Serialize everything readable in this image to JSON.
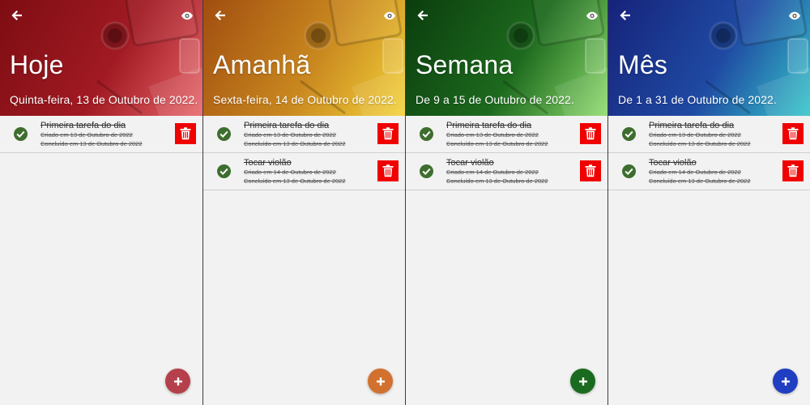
{
  "screens": [
    {
      "title": "Hoje",
      "subtitle": "Quinta-feira, 13 de Outubro de 2022.",
      "header_gradient": [
        "#7d0d12",
        "#a11a23",
        "#e8666a"
      ],
      "fab_color": "#b5404b",
      "tasks": [
        {
          "name": "Primeira tarefa do dia",
          "created": "Criado em 13 de Outubro de 2022",
          "done": "Concluído em 13 de Outubro de 2022"
        }
      ]
    },
    {
      "title": "Amanhã",
      "subtitle": "Sexta-feira, 14 de Outubro de 2022.",
      "header_gradient": [
        "#a14e10",
        "#c9881f",
        "#f3d23a"
      ],
      "fab_color": "#d2712f",
      "tasks": [
        {
          "name": "Primeira tarefa do dia",
          "created": "Criado em 13 de Outubro de 2022",
          "done": "Concluído em 13 de Outubro de 2022"
        },
        {
          "name": "Tocar violão",
          "created": "Criado em 14 de Outubro de 2022",
          "done": "Concluído em 13 de Outubro de 2022"
        }
      ]
    },
    {
      "title": "Semana",
      "subtitle": "De 9 a 15 de Outubro de 2022.",
      "header_gradient": [
        "#0b3d0e",
        "#1d6a1e",
        "#8fdc6e"
      ],
      "fab_color": "#1a6b1f",
      "tasks": [
        {
          "name": "Primeira tarefa do dia",
          "created": "Criado em 13 de Outubro de 2022",
          "done": "Concluído em 13 de Outubro de 2022"
        },
        {
          "name": "Tocar violão",
          "created": "Criado em 14 de Outubro de 2022",
          "done": "Concluído em 13 de Outubro de 2022"
        }
      ]
    },
    {
      "title": "Mês",
      "subtitle": "De 1 a 31 de Outubro de 2022.",
      "header_gradient": [
        "#16237a",
        "#1f4aa3",
        "#36c6c9"
      ],
      "fab_color": "#1f3ec2",
      "tasks": [
        {
          "name": "Primeira tarefa do dia",
          "created": "Criado em 13 de Outubro de 2022",
          "done": "Concluído em 13 de Outubro de 2022"
        },
        {
          "name": "Tocar violão",
          "created": "Criado em 14 de Outubro de 2022",
          "done": "Concluído em 13 de Outubro de 2022"
        }
      ]
    }
  ],
  "icons": {
    "back": "back-arrow-icon",
    "visibility": "eye-icon",
    "check": "check-circle-icon",
    "delete": "trash-icon",
    "add": "plus-icon"
  }
}
